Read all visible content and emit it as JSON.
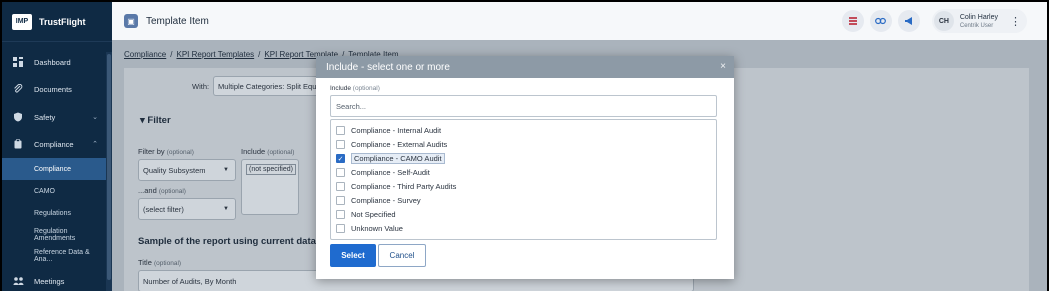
{
  "brand": {
    "logo": "IMP",
    "name": "TrustFlight"
  },
  "sidebar": {
    "items": [
      {
        "label": "Dashboard",
        "icon": "dashboard-icon"
      },
      {
        "label": "Documents",
        "icon": "paperclip-icon"
      },
      {
        "label": "Safety",
        "icon": "shield-icon"
      },
      {
        "label": "Compliance",
        "icon": "clipboard-icon"
      },
      {
        "label": "Compliance"
      },
      {
        "label": "CAMO"
      },
      {
        "label": "Regulations"
      },
      {
        "label": "Regulation Amendments"
      },
      {
        "label": "Reference Data & Ana..."
      },
      {
        "label": "Meetings",
        "icon": "meetings-icon"
      }
    ]
  },
  "topbar": {
    "title": "Template Item",
    "user": {
      "initials": "CH",
      "name": "Colin Harley",
      "role": "Centrik User"
    }
  },
  "breadcrumb": [
    "Compliance",
    "KPI Report Templates",
    "KPI Report Template",
    "Template Item"
  ],
  "background": {
    "with_label": "With:",
    "with_value": "Multiple Categories: Split Equ",
    "filter_title": "Filter",
    "filter_by_label": "Filter by",
    "optional": "(optional)",
    "filter_by_value": "Quality Subsystem",
    "include_label": "Include",
    "include_value": "(not specified)",
    "and_label": "...and",
    "and_value": "(select filter)",
    "sample_title": "Sample of the report using current data",
    "title_label": "Title",
    "title_value": "Number of Audits, By Month"
  },
  "modal": {
    "title": "Include - select one or more",
    "close": "×",
    "field_label": "Include",
    "field_optional": "(optional)",
    "search_placeholder": "Search...",
    "options": [
      {
        "label": "Compliance - Internal Audit",
        "checked": false
      },
      {
        "label": "Compliance - External Audits",
        "checked": false
      },
      {
        "label": "Compliance - CAMO Audit",
        "checked": true
      },
      {
        "label": "Compliance - Self-Audit",
        "checked": false
      },
      {
        "label": "Compliance - Third Party Audits",
        "checked": false
      },
      {
        "label": "Compliance - Survey",
        "checked": false
      },
      {
        "label": "Not Specified",
        "checked": false
      },
      {
        "label": "Unknown Value",
        "checked": false
      }
    ],
    "select_label": "Select",
    "cancel_label": "Cancel"
  }
}
